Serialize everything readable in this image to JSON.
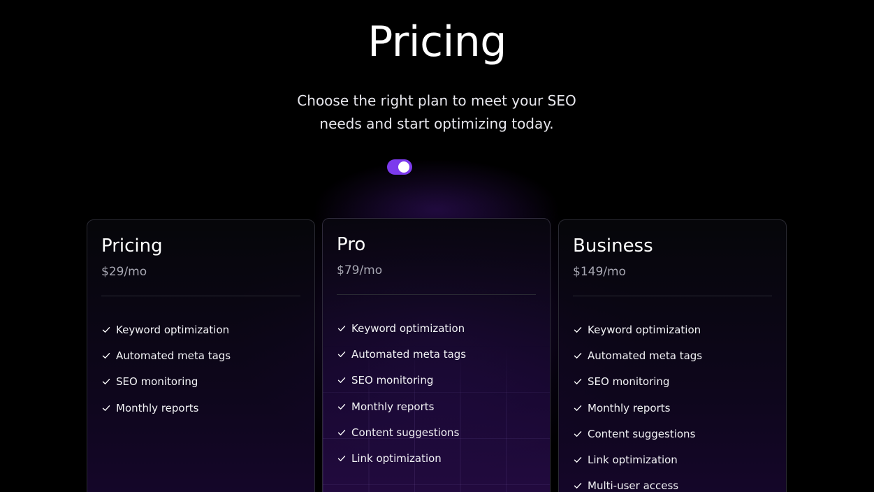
{
  "header": {
    "title": "Pricing",
    "subtitle": "Choose the right plan to meet your SEO needs and start optimizing today."
  },
  "billing_toggle": {
    "on": true,
    "accent_color": "#7c3aed"
  },
  "plans": [
    {
      "name": "Pricing",
      "price": "$29/mo",
      "features": [
        "Keyword optimization",
        "Automated meta tags",
        "SEO monitoring",
        "Monthly reports"
      ]
    },
    {
      "name": "Pro",
      "price": "$79/mo",
      "featured": true,
      "features": [
        "Keyword optimization",
        "Automated meta tags",
        "SEO monitoring",
        "Monthly reports",
        "Content suggestions",
        "Link optimization"
      ]
    },
    {
      "name": "Business",
      "price": "$149/mo",
      "features": [
        "Keyword optimization",
        "Automated meta tags",
        "SEO monitoring",
        "Monthly reports",
        "Content suggestions",
        "Link optimization",
        "Multi-user access"
      ]
    }
  ],
  "icons": {
    "feature_bullet": "check-icon"
  },
  "colors": {
    "background": "#000000",
    "accent": "#7c3aed",
    "muted_text": "#a7a7b2"
  }
}
